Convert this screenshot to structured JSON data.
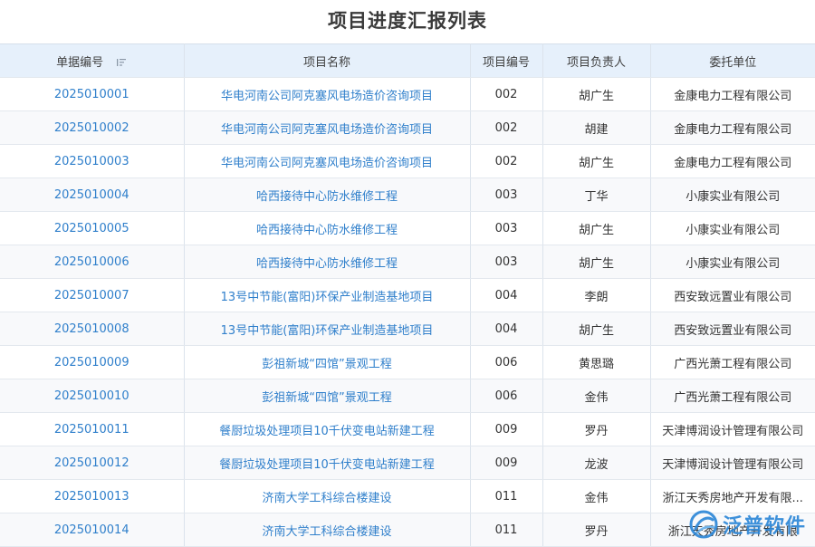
{
  "page_title": "项目进度汇报列表",
  "columns": {
    "id": "单据编号",
    "name": "项目名称",
    "code": "项目编号",
    "owner": "项目负责人",
    "client": "委托单位"
  },
  "sort_icon": "sort-list-icon",
  "rows": [
    {
      "id": "2025010001",
      "name": "华电河南公司阿克塞风电场造价咨询项目",
      "code": "002",
      "owner": "胡广生",
      "client": "金康电力工程有限公司"
    },
    {
      "id": "2025010002",
      "name": "华电河南公司阿克塞风电场造价咨询项目",
      "code": "002",
      "owner": "胡建",
      "client": "金康电力工程有限公司"
    },
    {
      "id": "2025010003",
      "name": "华电河南公司阿克塞风电场造价咨询项目",
      "code": "002",
      "owner": "胡广生",
      "client": "金康电力工程有限公司"
    },
    {
      "id": "2025010004",
      "name": "哈西接待中心防水维修工程",
      "code": "003",
      "owner": "丁华",
      "client": "小康实业有限公司"
    },
    {
      "id": "2025010005",
      "name": "哈西接待中心防水维修工程",
      "code": "003",
      "owner": "胡广生",
      "client": "小康实业有限公司"
    },
    {
      "id": "2025010006",
      "name": "哈西接待中心防水维修工程",
      "code": "003",
      "owner": "胡广生",
      "client": "小康实业有限公司"
    },
    {
      "id": "2025010007",
      "name": "13号中节能(富阳)环保产业制造基地项目",
      "code": "004",
      "owner": "李朗",
      "client": "西安致远置业有限公司"
    },
    {
      "id": "2025010008",
      "name": "13号中节能(富阳)环保产业制造基地项目",
      "code": "004",
      "owner": "胡广生",
      "client": "西安致远置业有限公司"
    },
    {
      "id": "2025010009",
      "name": "彭祖新城“四馆”景观工程",
      "code": "006",
      "owner": "黄思璐",
      "client": "广西光萧工程有限公司"
    },
    {
      "id": "2025010010",
      "name": "彭祖新城“四馆”景观工程",
      "code": "006",
      "owner": "金伟",
      "client": "广西光萧工程有限公司"
    },
    {
      "id": "2025010011",
      "name": "餐厨垃圾处理项目10千伏变电站新建工程",
      "code": "009",
      "owner": "罗丹",
      "client": "天津博润设计管理有限公司"
    },
    {
      "id": "2025010012",
      "name": "餐厨垃圾处理项目10千伏变电站新建工程",
      "code": "009",
      "owner": "龙波",
      "client": "天津博润设计管理有限公司"
    },
    {
      "id": "2025010013",
      "name": "济南大学工科综合楼建设",
      "code": "011",
      "owner": "金伟",
      "client": "浙江天秀房地产开发有限..."
    },
    {
      "id": "2025010014",
      "name": "济南大学工科综合楼建设",
      "code": "011",
      "owner": "罗丹",
      "client": "浙江天秀房地产开发有限"
    }
  ],
  "watermark": {
    "text": "泛普软件",
    "logo_icon": "fanpu-logo-icon"
  },
  "colors": {
    "link": "#2f7fcb",
    "header_bg": "#e6f0fb",
    "watermark": "#2e88d8"
  }
}
